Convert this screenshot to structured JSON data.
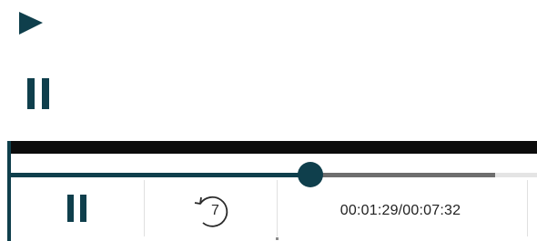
{
  "icons": {
    "standalone_play": "play-icon",
    "standalone_pause": "pause-icon",
    "control_pause": "pause-icon",
    "control_replay": "rewind-icon"
  },
  "colors": {
    "accent": "#0f3f4c",
    "video_strip": "#0c0c0c",
    "buffered": "#6e6e6e",
    "track": "#e4e4e4",
    "text": "#222222"
  },
  "player": {
    "replay_seconds": "7",
    "time_display": "00:01:29/00:07:32",
    "played_fraction": 0.57,
    "buffered_fraction": 0.92
  }
}
